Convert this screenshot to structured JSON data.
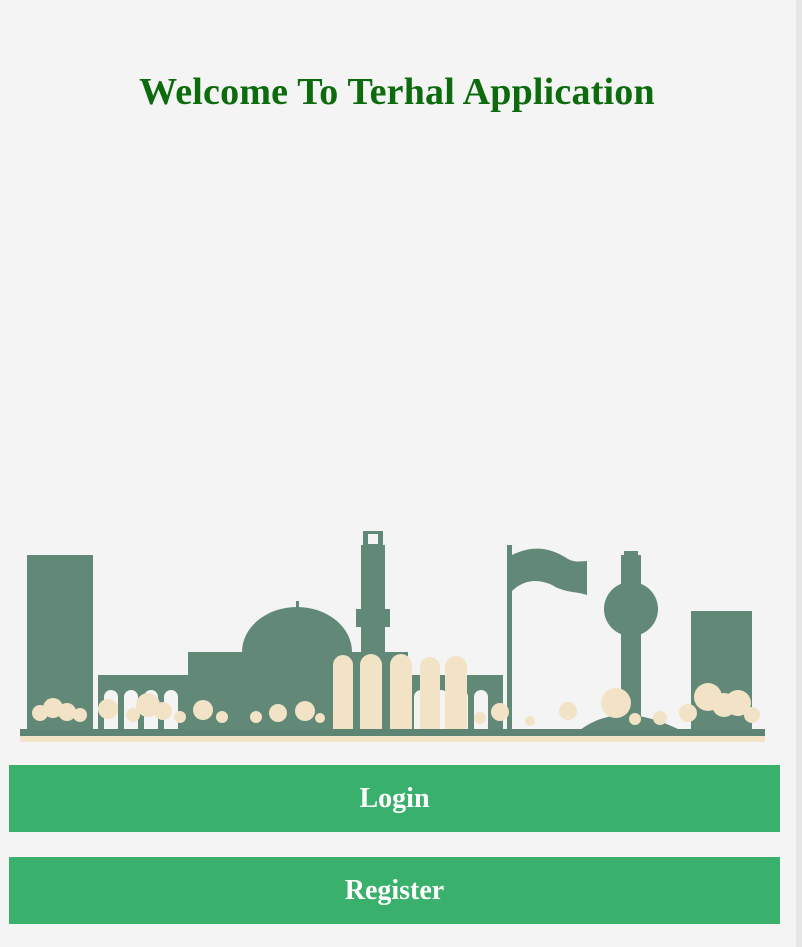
{
  "header": {
    "title": "Welcome To Terhal Application"
  },
  "illustration": {
    "icon": "city-skyline-illustration",
    "colors": {
      "buildings": "#628877",
      "trees": "#f2e3c6",
      "ground": "#5e8574"
    }
  },
  "actions": {
    "login_label": "Login",
    "register_label": "Register",
    "button_color": "#39b06b"
  },
  "colors": {
    "background": "#f4f4f4",
    "title": "#0c6b0c"
  }
}
